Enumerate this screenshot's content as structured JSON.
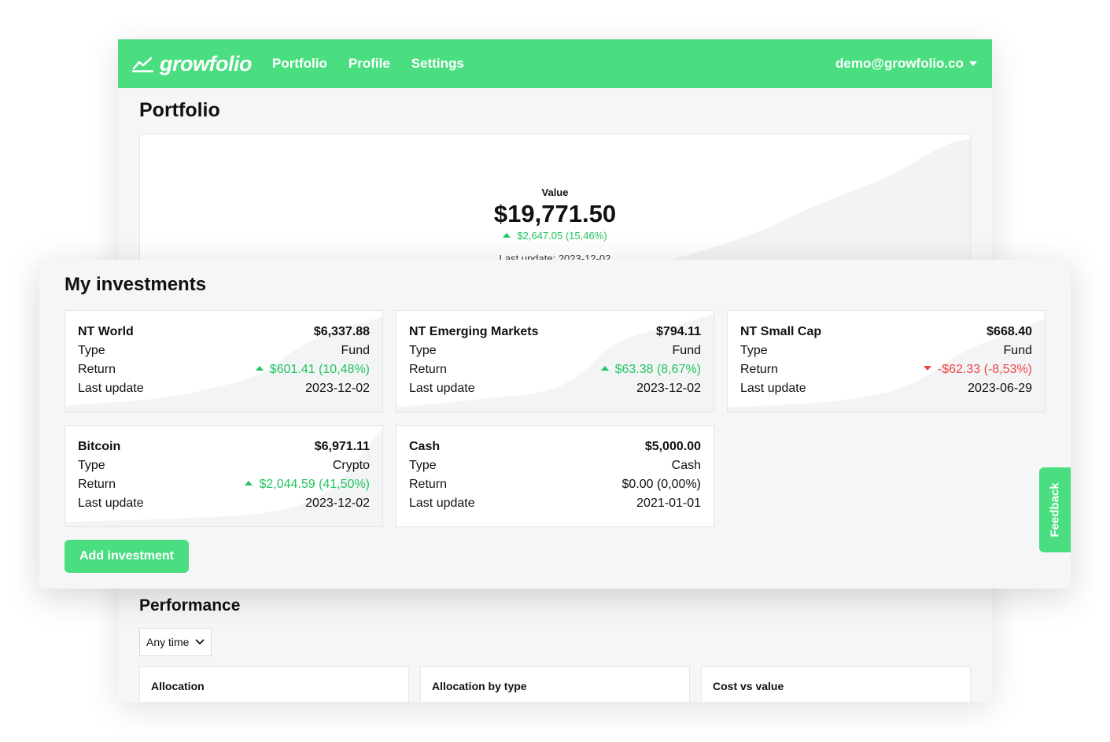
{
  "app": {
    "logo_text": "growfolio",
    "nav": [
      "Portfolio",
      "Profile",
      "Settings"
    ],
    "user_email": "demo@growfolio.co"
  },
  "portfolio": {
    "title": "Portfolio",
    "value_label": "Value",
    "value_amount": "$19,771.50",
    "value_change": "$2,647.05 (15,46%)",
    "last_update": "Last update: 2023-12-02"
  },
  "investments": {
    "title": "My investments",
    "row_labels": {
      "type": "Type",
      "return": "Return",
      "last_update": "Last update"
    },
    "items": [
      {
        "name": "NT World",
        "value": "$6,337.88",
        "type": "Fund",
        "return": "$601.41 (10,48%)",
        "trend": "up",
        "last_update": "2023-12-02"
      },
      {
        "name": "NT Emerging Markets",
        "value": "$794.11",
        "type": "Fund",
        "return": "$63.38 (8,67%)",
        "trend": "up",
        "last_update": "2023-12-02"
      },
      {
        "name": "NT Small Cap",
        "value": "$668.40",
        "type": "Fund",
        "return": "-$62.33 (-8,53%)",
        "trend": "down",
        "last_update": "2023-06-29"
      },
      {
        "name": "Bitcoin",
        "value": "$6,971.11",
        "type": "Crypto",
        "return": "$2,044.59 (41,50%)",
        "trend": "up",
        "last_update": "2023-12-02"
      },
      {
        "name": "Cash",
        "value": "$5,000.00",
        "type": "Cash",
        "return": "$0.00 (0,00%)",
        "trend": "flat",
        "last_update": "2021-01-01"
      }
    ],
    "add_button": "Add investment"
  },
  "feedback_label": "Feedback",
  "performance": {
    "title": "Performance",
    "period_select": "Any time",
    "cards": [
      "Allocation",
      "Allocation by type",
      "Cost vs value"
    ]
  },
  "colors": {
    "brand": "#4ade80",
    "positive": "#22c55e",
    "negative": "#ef4444"
  },
  "icons": {
    "logo": "trend-line-icon",
    "user_dropdown": "caret-down-icon",
    "select": "chevron-down-icon",
    "trend_up": "triangle-up-icon",
    "trend_down": "triangle-down-icon"
  }
}
